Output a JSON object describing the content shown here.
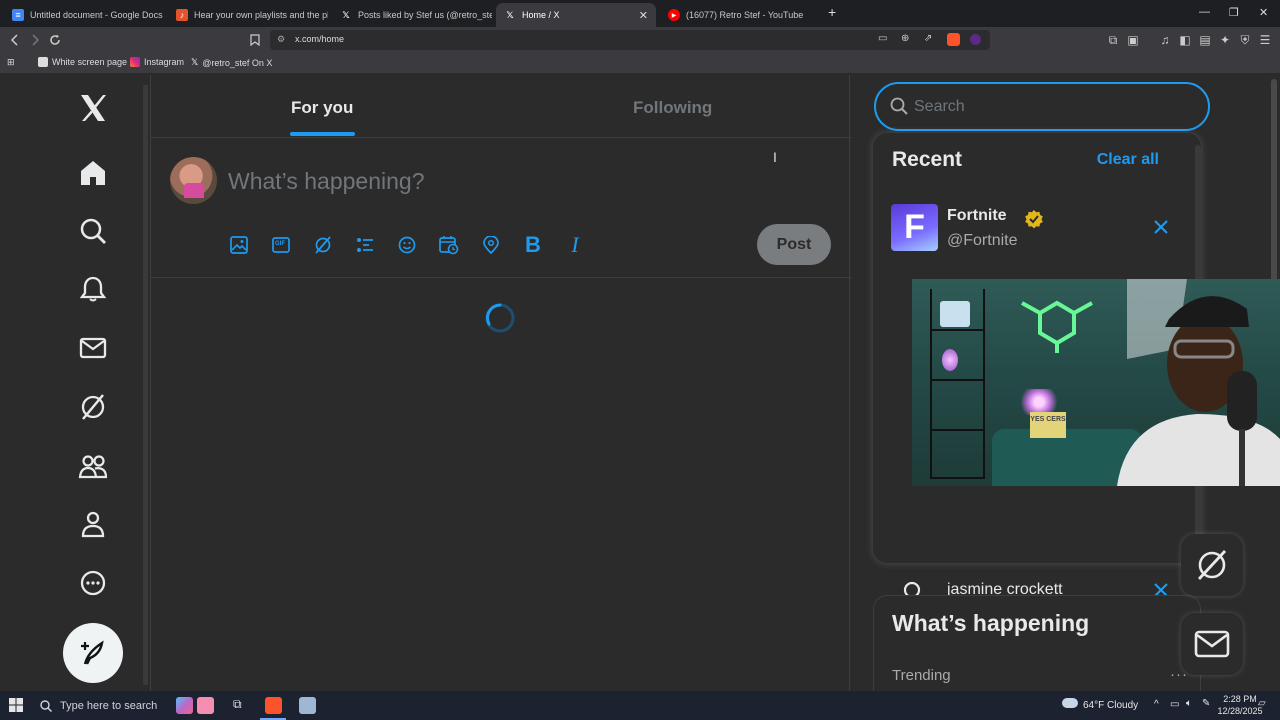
{
  "browser": {
    "tabs": [
      {
        "title": "Untitled document - Google Docs",
        "favicon": "docs-icon",
        "color": "#4285f4"
      },
      {
        "title": "Hear your own playlists and the play",
        "favicon": "music-icon",
        "color": "#e5532d"
      },
      {
        "title": "Posts liked by Stef us (@retro_stef) /",
        "favicon": "x-icon",
        "color": "#ffffff"
      },
      {
        "title": "Home / X",
        "favicon": "x-icon",
        "color": "#ffffff",
        "active": true
      },
      {
        "title": "(16077) Retro Stef - YouTube",
        "favicon": "youtube-icon",
        "color": "#ff0000"
      }
    ],
    "url": "x.com/home",
    "bookmarks": [
      {
        "label": "White screen page"
      },
      {
        "label": "Instagram"
      },
      {
        "label": "@retro_stef On X"
      }
    ]
  },
  "main": {
    "tabs": [
      {
        "label": "For you",
        "active": true
      },
      {
        "label": "Following",
        "active": false
      }
    ],
    "composer": {
      "placeholder": "What’s happening?",
      "post_label": "Post"
    },
    "toolbar_icons": [
      "image-icon",
      "gif-icon",
      "grok-icon",
      "poll-icon",
      "emoji-icon",
      "schedule-icon",
      "location-icon",
      "bold-icon",
      "italic-icon"
    ],
    "gif_label": "GIF",
    "bold_label": "B",
    "italic_label": "I"
  },
  "sidebar": {
    "search_placeholder": "Search",
    "recent": {
      "title": "Recent",
      "clear_label": "Clear all",
      "items": [
        {
          "name": "Fortnite",
          "handle": "@Fortnite",
          "verified": true,
          "logo_letter": "F"
        }
      ],
      "queries": [
        {
          "text": "jasmine crockett"
        }
      ]
    },
    "whats_happening": {
      "title": "What’s happening",
      "subtitle": "Trending",
      "more": "···"
    }
  },
  "webcam": {
    "sign_text": "YES CERS"
  },
  "taskbar": {
    "search_placeholder": "Type here to search",
    "weather": "64°F  Cloudy",
    "time": "2:28 PM",
    "date": "12/28/2025"
  },
  "colors": {
    "accent": "#1d9bf0",
    "background": "#2b2b2b",
    "text": "#e7e9ea",
    "muted": "#71767b"
  }
}
